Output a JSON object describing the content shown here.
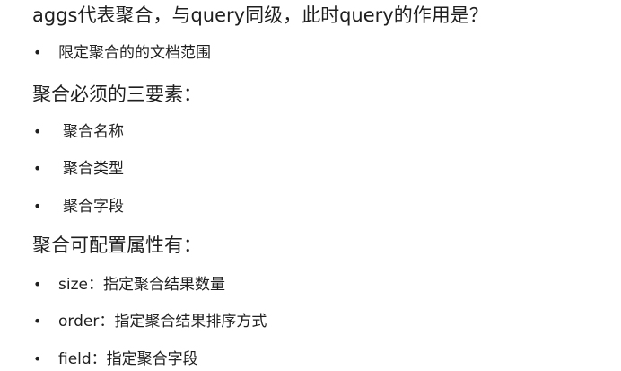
{
  "sections": [
    {
      "heading": "aggs代表聚合，与query同级，此时query的作用是？",
      "items": [
        "限定聚合的的文档范围"
      ]
    },
    {
      "heading": "聚合必须的三要素：",
      "items": [
        "聚合名称",
        "聚合类型",
        "聚合字段"
      ]
    },
    {
      "heading": "聚合可配置属性有：",
      "items": [
        "size：指定聚合结果数量",
        "order：指定聚合结果排序方式",
        "field：指定聚合字段"
      ]
    }
  ],
  "bullet": "•"
}
